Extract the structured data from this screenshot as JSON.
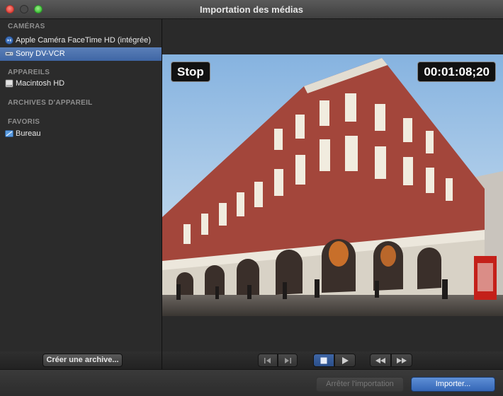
{
  "window": {
    "title": "Importation des médias"
  },
  "sidebar": {
    "sections": [
      {
        "header": "CAMÉRAS",
        "items": [
          {
            "label": "Apple Caméra FaceTime HD (intégrée)",
            "icon": "facetime-camera-icon",
            "selected": false
          },
          {
            "label": "Sony DV-VCR",
            "icon": "dv-vcr-icon",
            "selected": true
          }
        ]
      },
      {
        "header": "APPAREILS",
        "items": [
          {
            "label": "Macintosh HD",
            "icon": "hard-drive-icon",
            "selected": false
          }
        ]
      },
      {
        "header": "ARCHIVES D'APPAREIL",
        "items": []
      },
      {
        "header": "FAVORIS",
        "items": [
          {
            "label": "Bureau",
            "icon": "desktop-folder-icon",
            "selected": false
          }
        ]
      }
    ],
    "footer_button": "Créer une archive..."
  },
  "viewer": {
    "status": "Stop",
    "timecode": "00:01:08;20"
  },
  "transport": {
    "buttons": [
      "step-back",
      "step-forward",
      "stop",
      "play",
      "rewind",
      "fast-forward"
    ]
  },
  "actions": {
    "stop_import": "Arrêter l'importation",
    "import": "Importer..."
  },
  "colors": {
    "selection": "#3f66a5",
    "import_button": "#3466b6",
    "close": "#e0443b",
    "maximize": "#3fbf3a"
  }
}
